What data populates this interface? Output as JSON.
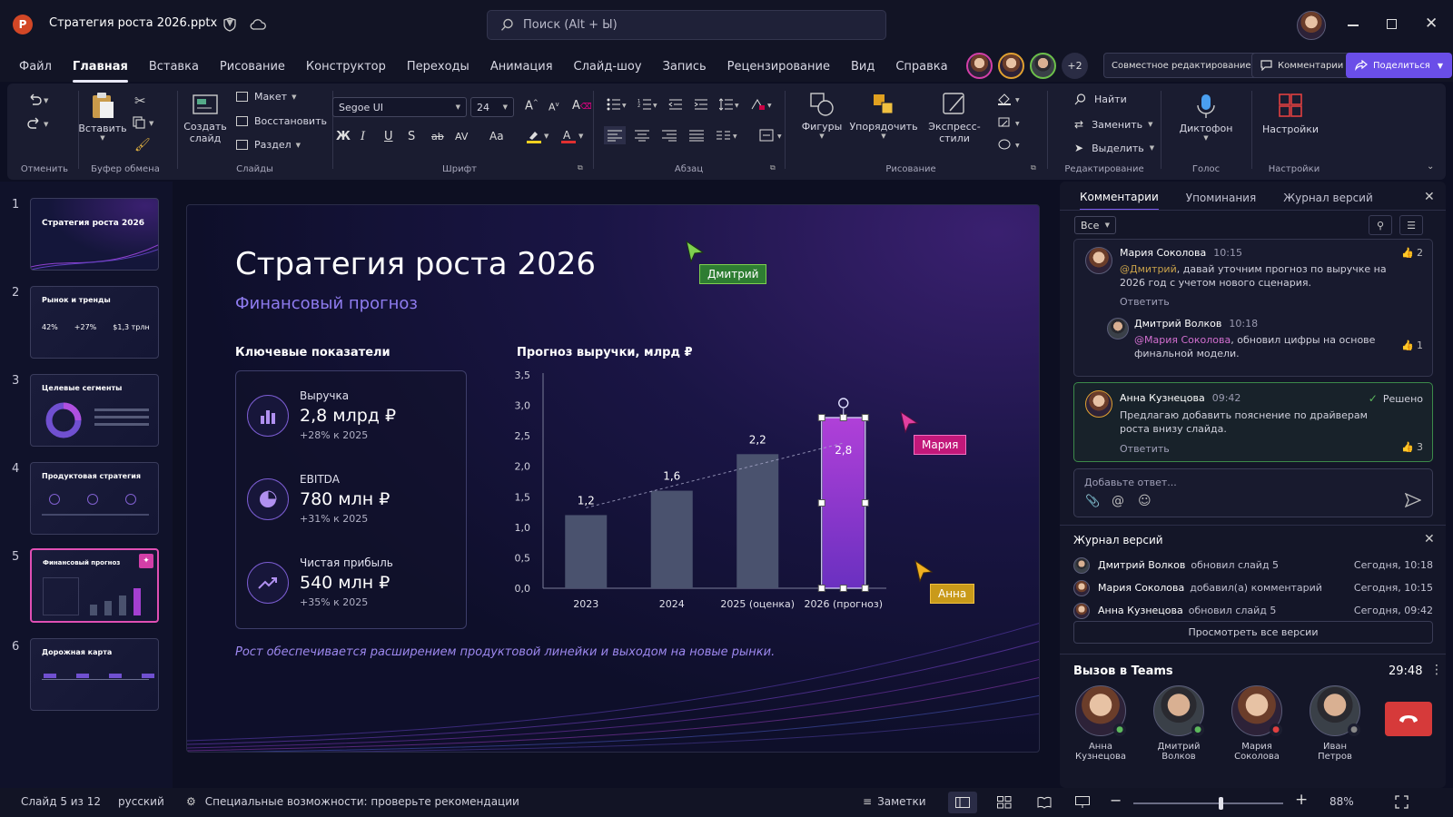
{
  "app": {
    "file_title": "Стратегия роста 2026.pptx",
    "search_placeholder": "Поиск (Alt + Ы)",
    "tabs": [
      "Файл",
      "Главная",
      "Вставка",
      "Рисование",
      "Конструктор",
      "Переходы",
      "Анимация",
      "Слайд-шоу",
      "Запись",
      "Рецензирование",
      "Вид",
      "Справка"
    ],
    "active_tab": "Главная",
    "collab_more": "+2",
    "coedit_label": "Совместное редактирование",
    "comments_label": "Комментарии",
    "share_label": "Поделиться"
  },
  "ribbon": {
    "undo_group": "Отменить",
    "clipboard": {
      "paste": "Вставить",
      "group": "Буфер обмена"
    },
    "slides": {
      "new_slide": "Создать слайд",
      "layout": "Макет",
      "reset": "Восстановить",
      "section": "Раздел",
      "group": "Слайды"
    },
    "font": {
      "name": "Segoe UI",
      "size": "24",
      "group": "Шрифт",
      "bold": "Ж",
      "italic": "I",
      "underline": "U",
      "shadow": "S",
      "strike": "ab",
      "spacing": "AV",
      "case": "Aa"
    },
    "paragraph": {
      "group": "Абзац"
    },
    "drawing": {
      "shapes": "Фигуры",
      "arrange": "Упорядочить",
      "quick_styles": "Экспресс-стили",
      "group": "Рисование"
    },
    "editing": {
      "find": "Найти",
      "replace": "Заменить",
      "select": "Выделить",
      "group": "Редактирование"
    },
    "voice": {
      "dictate": "Диктофон",
      "group": "Голос"
    },
    "settings": {
      "addins": "Настройки",
      "group": "Настройки"
    }
  },
  "thumbnails": [
    {
      "num": "1",
      "title": "Стратегия роста 2026"
    },
    {
      "num": "2",
      "title": "Рынок и тренды",
      "stats": [
        "42%",
        "+27%",
        "$1,3 трлн"
      ]
    },
    {
      "num": "3",
      "title": "Целевые сегменты"
    },
    {
      "num": "4",
      "title": "Продуктовая стратегия"
    },
    {
      "num": "5",
      "title": "Финансовый прогноз"
    },
    {
      "num": "6",
      "title": "Дорожная карта"
    }
  ],
  "slide": {
    "title": "Стратегия роста 2026",
    "subtitle": "Финансовый прогноз",
    "kpi_heading": "Ключевые показатели",
    "kpis": [
      {
        "label": "Выручка",
        "value": "2,8 млрд ₽",
        "sub": "+28% к 2025"
      },
      {
        "label": "EBITDA",
        "value": "780 млн ₽",
        "sub": "+31% к 2025"
      },
      {
        "label": "Чистая прибыль",
        "value": "540 млн ₽",
        "sub": "+35% к 2025"
      }
    ],
    "footer": "Рост обеспечивается расширением продуктовой линейки и выходом на новые рынки.",
    "cursors": {
      "c1": "Дмитрий",
      "c2": "Мария",
      "c3": "Анна"
    }
  },
  "chart_data": {
    "type": "bar",
    "title": "Прогноз выручки, млрд ₽",
    "categories": [
      "2023",
      "2024",
      "2025 (оценка)",
      "2026 (прогноз)"
    ],
    "values": [
      1.2,
      1.6,
      2.2,
      2.8
    ],
    "value_labels": [
      "1,2",
      "1,6",
      "2,2",
      "2,8"
    ],
    "ylim": [
      0,
      3.5
    ],
    "yticks": [
      "0,0",
      "0,5",
      "1,0",
      "1,5",
      "2,0",
      "2,5",
      "3,0",
      "3,5"
    ],
    "colors": {
      "bar": "#4a526e",
      "highlight": "#a43fd0"
    },
    "trendline": true
  },
  "comments": {
    "tabs": [
      "Комментарии",
      "Упоминания",
      "Журнал версий"
    ],
    "filter": "Все",
    "thread1": {
      "name": "Мария Соколова",
      "time": "10:15",
      "mention": "@Дмитрий",
      "text": ", давай уточним прогноз по выручке на 2026 год с учетом нового сценария.",
      "likes": "2",
      "reply": "Ответить",
      "sub": {
        "name": "Дмитрий Волков",
        "time": "10:18",
        "mention": "@Мария Соколова",
        "text": ", обновил цифры на основе финальной модели.",
        "likes": "1"
      }
    },
    "thread2": {
      "name": "Анна Кузнецова",
      "time": "09:42",
      "resolved": "Решено",
      "text": "Предлагаю добавить пояснение по драйверам роста внизу слайда.",
      "likes": "3",
      "reply": "Ответить"
    },
    "reply_placeholder": "Добавьте ответ..."
  },
  "versions": {
    "title": "Журнал версий",
    "items": [
      {
        "name": "Дмитрий Волков",
        "action": "обновил слайд 5",
        "time": "Сегодня, 10:18"
      },
      {
        "name": "Мария Соколова",
        "action": "добавил(а) комментарий",
        "time": "Сегодня, 10:15"
      },
      {
        "name": "Анна Кузнецова",
        "action": "обновил слайд 5",
        "time": "Сегодня, 09:42"
      }
    ],
    "view_all": "Просмотреть все версии"
  },
  "teams": {
    "title": "Вызов в Teams",
    "timer": "29:48",
    "people": [
      {
        "first": "Анна",
        "last": "Кузнецова"
      },
      {
        "first": "Дмитрий",
        "last": "Волков"
      },
      {
        "first": "Мария",
        "last": "Соколова"
      },
      {
        "first": "Иван",
        "last": "Петров"
      }
    ]
  },
  "status": {
    "slide": "Слайд 5 из 12",
    "lang": "русский",
    "accessibility": "Специальные возможности: проверьте рекомендации",
    "notes": "Заметки",
    "zoom": "88%",
    "zoom_fraction": 0.58
  },
  "colors": {
    "accent": "#7b5cf0",
    "share": "#6a4ee8",
    "magenta": "#d23fa8",
    "green": "#5cb85c",
    "cursor_green": "#2e7d32",
    "cursor_pink": "#c2187a",
    "cursor_gold": "#c99a1a"
  }
}
